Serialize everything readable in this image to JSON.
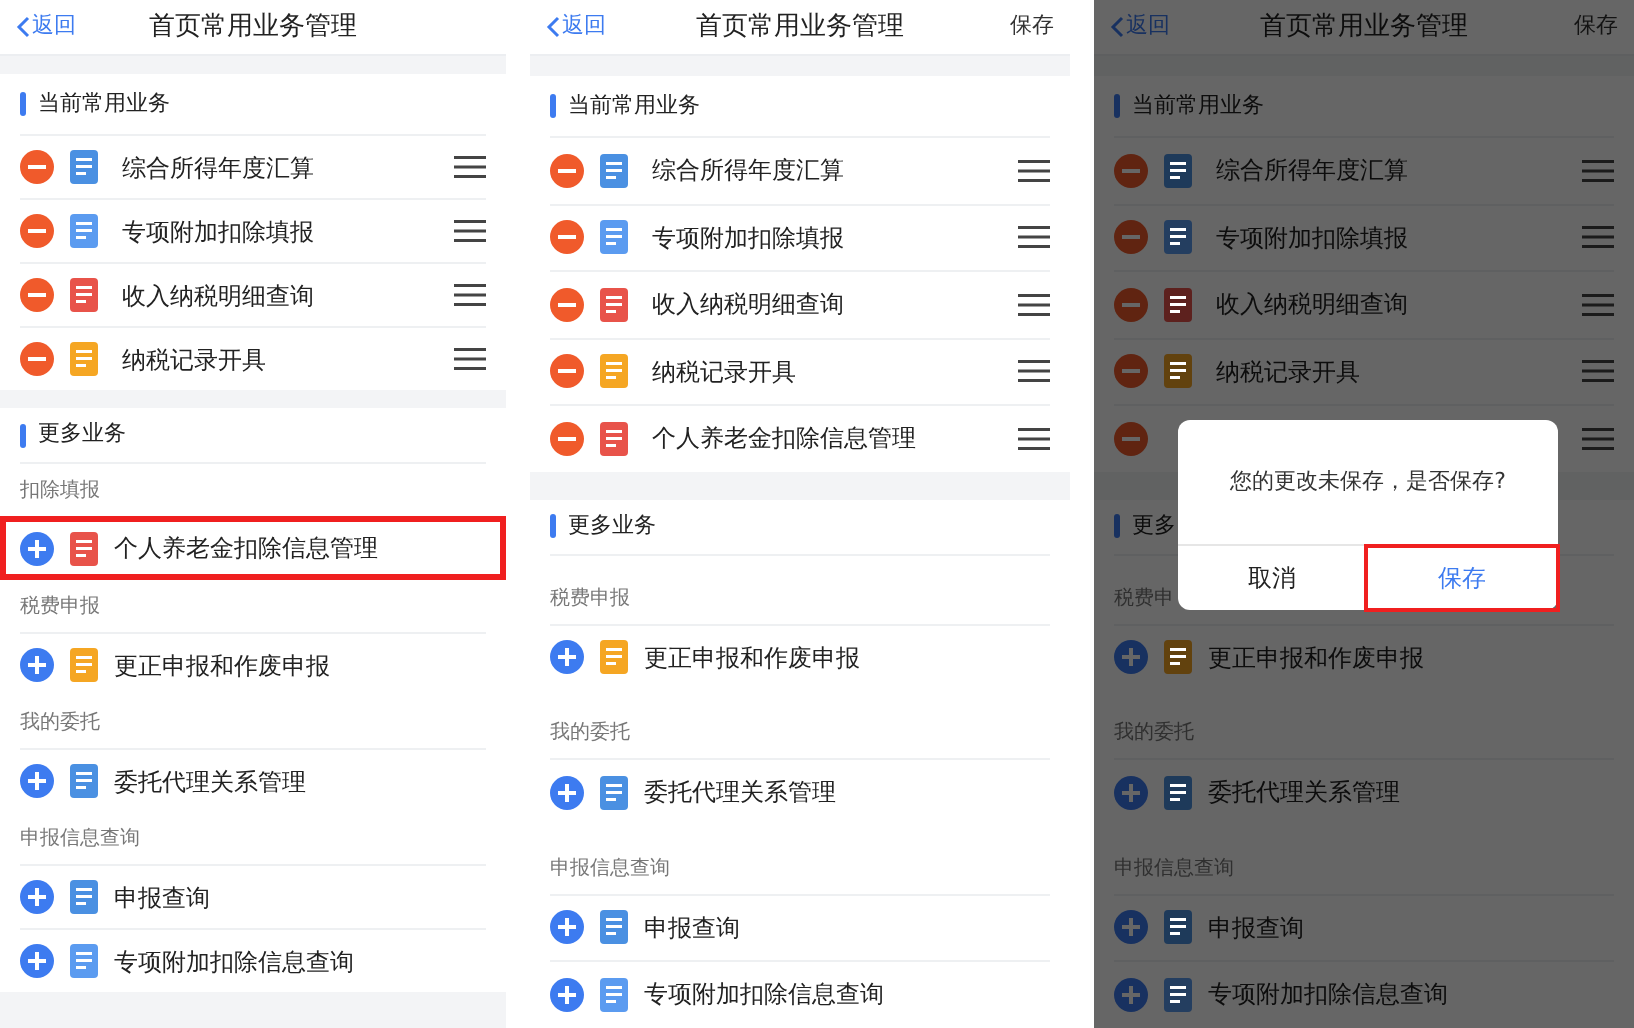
{
  "panels": [
    {
      "header": {
        "back": "返回",
        "title": "首页常用业务管理"
      },
      "current": {
        "title": "当前常用业务",
        "items": [
          {
            "label": "综合所得年度汇算",
            "color": "#4a90e2"
          },
          {
            "label": "专项附加扣除填报",
            "color": "#5b9bf0"
          },
          {
            "label": "收入纳税明细查询",
            "color": "#e8534a"
          },
          {
            "label": "纳税记录开具",
            "color": "#f5a623"
          }
        ]
      },
      "more": {
        "title": "更多业务",
        "groups": [
          {
            "label": "扣除填报",
            "items": [
              {
                "label": "个人养老金扣除信息管理",
                "color": "#e8534a",
                "highlighted": true
              }
            ]
          },
          {
            "label": "税费申报",
            "items": [
              {
                "label": "更正申报和作废申报",
                "color": "#f5a623",
                "highlighted": false
              }
            ]
          },
          {
            "label": "我的委托",
            "items": [
              {
                "label": "委托代理关系管理",
                "color": "#4a90e2",
                "highlighted": false
              }
            ]
          },
          {
            "label": "申报信息查询",
            "items": [
              {
                "label": "申报查询",
                "color": "#4a90e2",
                "highlighted": false
              },
              {
                "label": "专项附加扣除信息查询",
                "color": "#5b9bf0",
                "highlighted": false
              }
            ]
          }
        ]
      }
    },
    {
      "header": {
        "back": "返回",
        "title": "首页常用业务管理",
        "save": "保存"
      },
      "current": {
        "title": "当前常用业务",
        "items": [
          {
            "label": "综合所得年度汇算",
            "color": "#4a90e2"
          },
          {
            "label": "专项附加扣除填报",
            "color": "#5b9bf0"
          },
          {
            "label": "收入纳税明细查询",
            "color": "#e8534a"
          },
          {
            "label": "纳税记录开具",
            "color": "#f5a623"
          },
          {
            "label": "个人养老金扣除信息管理",
            "color": "#e8534a"
          }
        ]
      },
      "more": {
        "title": "更多业务",
        "groups": [
          {
            "label": "税费申报",
            "items": [
              {
                "label": "更正申报和作废申报",
                "color": "#f5a623",
                "highlighted": false
              }
            ]
          },
          {
            "label": "我的委托",
            "items": [
              {
                "label": "委托代理关系管理",
                "color": "#4a90e2",
                "highlighted": false
              }
            ]
          },
          {
            "label": "申报信息查询",
            "items": [
              {
                "label": "申报查询",
                "color": "#4a90e2",
                "highlighted": false
              },
              {
                "label": "专项附加扣除信息查询",
                "color": "#5b9bf0",
                "highlighted": false
              }
            ]
          }
        ]
      }
    },
    {
      "header": {
        "back": "返回",
        "title": "首页常用业务管理",
        "save": "保存"
      },
      "current": {
        "title": "当前常用业务",
        "items": [
          {
            "label": "综合所得年度汇算",
            "color": "#1e3a5a"
          },
          {
            "label": "专项附加扣除填报",
            "color": "#243e60"
          },
          {
            "label": "收入纳税明细查询",
            "color": "#5d211e"
          },
          {
            "label": "纳税记录开具",
            "color": "#62420e"
          },
          {
            "covered": true
          }
        ]
      },
      "more": {
        "title": "更多",
        "groups": [
          {
            "label": "税费申",
            "items": [
              {
                "label": "更正申报和作废申报",
                "color": "#62420e",
                "highlighted": false
              }
            ]
          },
          {
            "label": "我的委托",
            "items": [
              {
                "label": "委托代理关系管理",
                "color": "#1e3a5a",
                "highlighted": false
              }
            ]
          },
          {
            "label": "申报信息查询",
            "items": [
              {
                "label": "申报查询",
                "color": "#1e3a5a",
                "highlighted": false
              },
              {
                "label": "专项附加扣除信息查询",
                "color": "#243e60",
                "highlighted": false
              }
            ]
          }
        ]
      },
      "dimmed": true,
      "dialog": {
        "message": "您的更改未保存，是否保存?",
        "buttons": [
          {
            "label": "取消",
            "highlighted": false
          },
          {
            "label": "保存",
            "highlighted": true
          }
        ]
      }
    }
  ]
}
